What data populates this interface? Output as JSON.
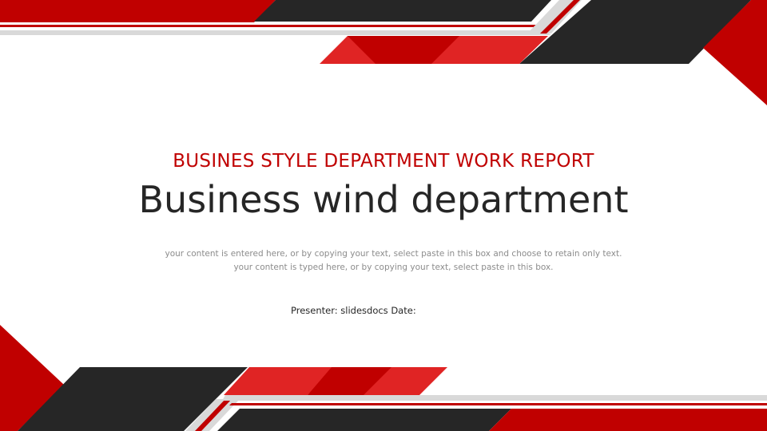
{
  "slide": {
    "subtitle": "BUSINES STYLE DEPARTMENT WORK REPORT",
    "title": "Business wind department",
    "body": "your content is entered here, or by copying your text, select paste in this box and choose to retain only text. your content is typed here, or by copying your text, select paste in this box.",
    "presenter": "Presenter: slidesdocs Date:"
  },
  "theme": {
    "accent_red": "#c00000",
    "bright_red": "#e02424",
    "dark": "#262626",
    "gray_stripe": "#d9d9d9",
    "body_gray": "#8c8c8c"
  }
}
